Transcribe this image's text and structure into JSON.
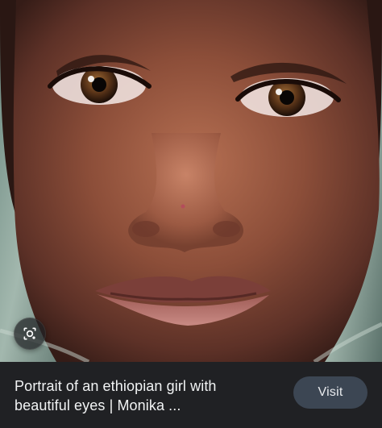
{
  "result": {
    "title": "Portrait of an ethiopian girl with beautiful eyes | Monika ...",
    "visit_label": "Visit"
  },
  "icons": {
    "lens": "lens-icon"
  },
  "colors": {
    "caption_background": "#202124",
    "visit_button_background": "#3c4653",
    "text_primary": "#f1f3f4"
  }
}
